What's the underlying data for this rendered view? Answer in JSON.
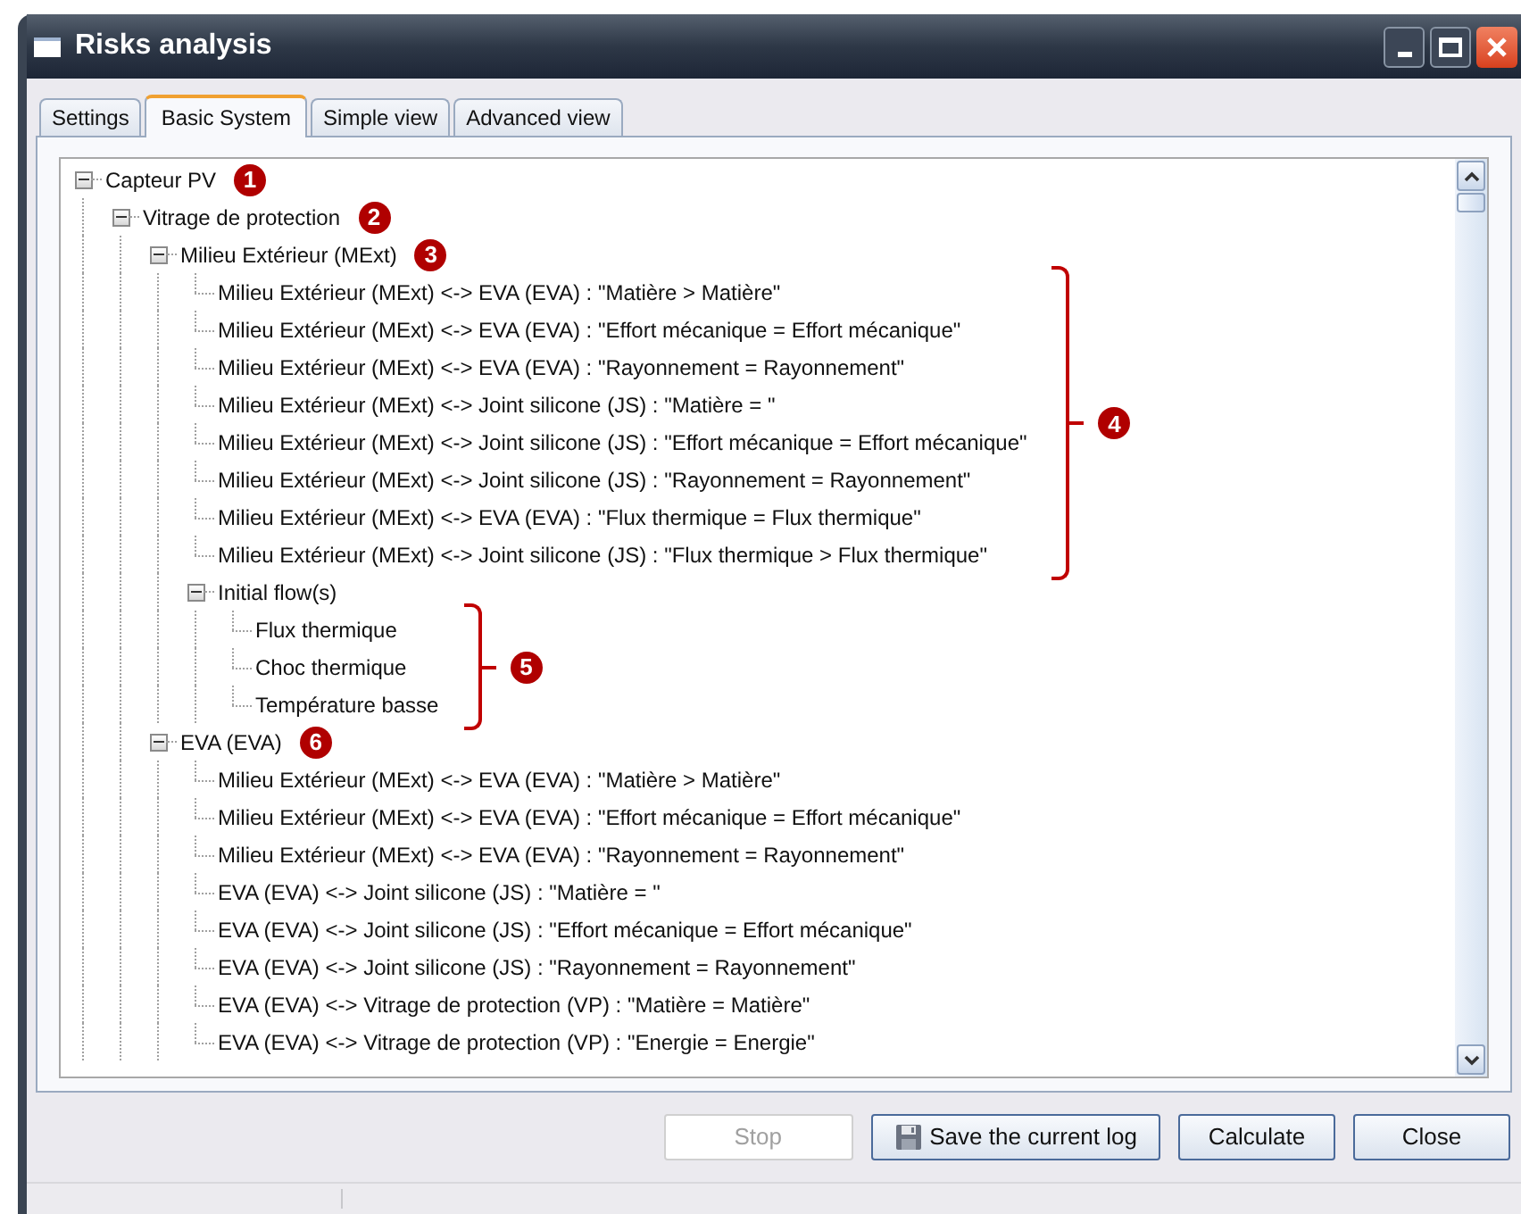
{
  "window": {
    "title": "Risks analysis"
  },
  "tabs": [
    {
      "label": "Settings",
      "selected": false
    },
    {
      "label": "Basic System",
      "selected": true
    },
    {
      "label": "Simple view",
      "selected": false
    },
    {
      "label": "Advanced view",
      "selected": false
    }
  ],
  "tree": [
    {
      "label": "Capteur PV",
      "callout": "1",
      "expanded": true,
      "children": [
        {
          "label": "Vitrage de protection",
          "callout": "2",
          "expanded": true,
          "children": [
            {
              "label": "Milieu Extérieur (MExt)",
              "callout": "3",
              "expanded": true,
              "leaves_callout": "4",
              "children": [
                {
                  "label": "Milieu Extérieur (MExt) <-> EVA (EVA) : \"Matière > Matière\""
                },
                {
                  "label": "Milieu Extérieur (MExt) <-> EVA (EVA) : \"Effort mécanique = Effort mécanique\""
                },
                {
                  "label": "Milieu Extérieur (MExt) <-> EVA (EVA) : \"Rayonnement = Rayonnement\""
                },
                {
                  "label": "Milieu Extérieur (MExt) <-> Joint silicone (JS) : \"Matière = \""
                },
                {
                  "label": "Milieu Extérieur (MExt) <-> Joint silicone (JS) : \"Effort mécanique = Effort mécanique\""
                },
                {
                  "label": "Milieu Extérieur (MExt) <-> Joint silicone (JS) : \"Rayonnement = Rayonnement\""
                },
                {
                  "label": "Milieu Extérieur (MExt) <-> EVA (EVA) : \"Flux thermique = Flux thermique\""
                },
                {
                  "label": "Milieu Extérieur (MExt) <-> Joint silicone (JS) : \"Flux thermique > Flux thermique\""
                },
                {
                  "label": "Initial flow(s)",
                  "expanded": true,
                  "leaves_callout": "5",
                  "children": [
                    {
                      "label": "Flux thermique"
                    },
                    {
                      "label": "Choc thermique"
                    },
                    {
                      "label": "Température basse"
                    }
                  ]
                }
              ]
            },
            {
              "label": "EVA (EVA)",
              "callout": "6",
              "expanded": true,
              "children": [
                {
                  "label": "Milieu Extérieur (MExt) <-> EVA (EVA) : \"Matière > Matière\""
                },
                {
                  "label": "Milieu Extérieur (MExt) <-> EVA (EVA) : \"Effort mécanique = Effort mécanique\""
                },
                {
                  "label": "Milieu Extérieur (MExt) <-> EVA (EVA) : \"Rayonnement = Rayonnement\""
                },
                {
                  "label": "EVA (EVA) <-> Joint silicone (JS) : \"Matière = \""
                },
                {
                  "label": "EVA (EVA) <-> Joint silicone (JS) : \"Effort mécanique = Effort mécanique\""
                },
                {
                  "label": "EVA (EVA) <-> Joint silicone (JS) : \"Rayonnement = Rayonnement\""
                },
                {
                  "label": "EVA (EVA) <-> Vitrage de protection (VP) : \"Matière = Matière\""
                },
                {
                  "label": "EVA (EVA) <-> Vitrage de protection (VP) : \"Energie = Energie\""
                }
              ]
            }
          ]
        }
      ]
    }
  ],
  "buttons": [
    {
      "label": "Stop",
      "kind": "plain",
      "disabled": true
    },
    {
      "label": "Save the current log",
      "kind": "save",
      "disabled": false
    },
    {
      "label": "Calculate",
      "kind": "plain",
      "disabled": false
    },
    {
      "label": "Close",
      "kind": "plain",
      "disabled": false
    }
  ]
}
